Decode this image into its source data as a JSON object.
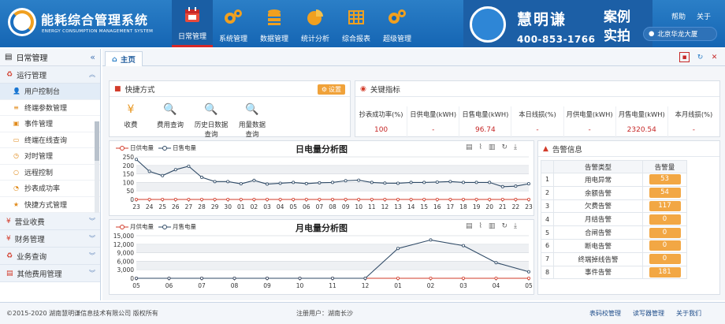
{
  "header": {
    "brand_cn": "能耗综合管理系统",
    "brand_en": "ENERGY CONSUMPTION MANAGEMENT SYSTEM",
    "nav": [
      {
        "label": "日常管理",
        "icon": "calendar-icon",
        "active": true
      },
      {
        "label": "系统管理",
        "icon": "gears-icon"
      },
      {
        "label": "数据管理",
        "icon": "database-icon"
      },
      {
        "label": "统计分析",
        "icon": "pie-chart-icon"
      },
      {
        "label": "综合报表",
        "icon": "table-icon"
      },
      {
        "label": "超级管理",
        "icon": "gears-icon"
      }
    ],
    "promo_name": "慧明谦",
    "promo_tel": "400-853-1766",
    "promo_tag": "案例实拍",
    "help": "帮助",
    "about": "关于",
    "location": "北京华龙大厦"
  },
  "sidebar": {
    "title": "日常管理",
    "group_active": "运行管理",
    "items": [
      {
        "label": "用户控制台",
        "icon": "user-icon",
        "selected": true
      },
      {
        "label": "终端参数管理",
        "icon": "list-icon"
      },
      {
        "label": "事件管理",
        "icon": "bell-icon"
      },
      {
        "label": "终端在线查询",
        "icon": "monitor-icon"
      },
      {
        "label": "对时管理",
        "icon": "clock-icon"
      },
      {
        "label": "远程控制",
        "icon": "search-icon"
      },
      {
        "label": "抄表成功率",
        "icon": "chart-icon"
      },
      {
        "label": "快捷方式管理",
        "icon": "star-icon"
      }
    ],
    "groups": [
      "营业收费",
      "财务管理",
      "业务查询",
      "其他费用管理"
    ]
  },
  "tab": {
    "label": "主页"
  },
  "shortcuts": {
    "title": "快捷方式",
    "set_label": "设置",
    "items": [
      {
        "label": "收费",
        "icon": "yen-icon"
      },
      {
        "label": "费用查询",
        "icon": "search-icon"
      },
      {
        "label": "历史日数据查询",
        "icon": "search-icon"
      },
      {
        "label": "用量数据查询",
        "icon": "search-icon"
      }
    ]
  },
  "kpi": {
    "title": "关键指标",
    "items": [
      {
        "label": "抄表成功率(%)",
        "value": "100"
      },
      {
        "label": "日供电量(kWH)",
        "value": "-"
      },
      {
        "label": "日售电量(kWH)",
        "value": "96.74"
      },
      {
        "label": "本日线损(%)",
        "value": "-"
      },
      {
        "label": "月供电量(kWH)",
        "value": "-"
      },
      {
        "label": "月售电量(kWH)",
        "value": "2320.54"
      },
      {
        "label": "本月线损(%)",
        "value": "-"
      }
    ]
  },
  "alarms": {
    "title": "告警信息",
    "col_type": "告警类型",
    "col_count": "告警量",
    "rows": [
      {
        "idx": "1",
        "type": "用电异常",
        "count": "53"
      },
      {
        "idx": "2",
        "type": "余额告警",
        "count": "54"
      },
      {
        "idx": "3",
        "type": "欠费告警",
        "count": "117"
      },
      {
        "idx": "4",
        "type": "月结告警",
        "count": "0"
      },
      {
        "idx": "5",
        "type": "合闸告警",
        "count": "0"
      },
      {
        "idx": "6",
        "type": "断电告警",
        "count": "0"
      },
      {
        "idx": "7",
        "type": "终端掉线告警",
        "count": "0"
      },
      {
        "idx": "8",
        "type": "事件告警",
        "count": "181"
      }
    ]
  },
  "footer": {
    "copyright": "©2015-2020 湖南慧明谦信息技术有限公司 版权所有",
    "user": "注册用户：湖南长沙",
    "links": [
      "表码校管理",
      "读写器管理",
      "关于我们"
    ]
  },
  "colors": {
    "supply": "#d23b2a",
    "sale": "#2f4a66",
    "header": "#1b6cbf",
    "badge": "#f2a744"
  },
  "chart_data": [
    {
      "type": "line",
      "title": "日电量分析图",
      "legend": [
        "日供电量",
        "日售电量"
      ],
      "categories": [
        "23",
        "24",
        "25",
        "26",
        "27",
        "28",
        "29",
        "30",
        "01",
        "02",
        "03",
        "04",
        "05",
        "06",
        "07",
        "08",
        "09",
        "10",
        "11",
        "12",
        "13",
        "14",
        "15",
        "16",
        "17",
        "18",
        "19",
        "20",
        "21",
        "22",
        "23"
      ],
      "series": [
        {
          "name": "日供电量",
          "values": [
            0,
            0,
            0,
            0,
            0,
            0,
            0,
            0,
            0,
            0,
            0,
            0,
            0,
            0,
            0,
            0,
            0,
            0,
            0,
            0,
            0,
            0,
            0,
            0,
            0,
            0,
            0,
            0,
            0,
            0,
            0
          ]
        },
        {
          "name": "日售电量",
          "values": [
            235,
            165,
            140,
            175,
            195,
            130,
            105,
            105,
            92,
            112,
            90,
            95,
            100,
            93,
            98,
            100,
            110,
            113,
            100,
            96,
            95,
            100,
            100,
            102,
            105,
            100,
            100,
            100,
            75,
            78,
            92
          ]
        }
      ],
      "ylim": [
        0,
        250
      ],
      "yticks": [
        0,
        50,
        100,
        150,
        200,
        250
      ],
      "grid": true
    },
    {
      "type": "line",
      "title": "月电量分析图",
      "legend": [
        "月供电量",
        "月售电量"
      ],
      "categories": [
        "05",
        "06",
        "07",
        "08",
        "09",
        "10",
        "11",
        "12",
        "01",
        "02",
        "03",
        "04",
        "05"
      ],
      "series": [
        {
          "name": "月供电量",
          "values": [
            0,
            0,
            0,
            0,
            0,
            0,
            0,
            0,
            0,
            0,
            0,
            0,
            0
          ]
        },
        {
          "name": "月售电量",
          "values": [
            0,
            0,
            0,
            0,
            0,
            0,
            0,
            0,
            10500,
            13500,
            11500,
            5500,
            2300
          ]
        }
      ],
      "ylim": [
        0,
        15000
      ],
      "yticks": [
        0,
        3000,
        6000,
        9000,
        12000,
        15000
      ],
      "grid": true
    }
  ]
}
